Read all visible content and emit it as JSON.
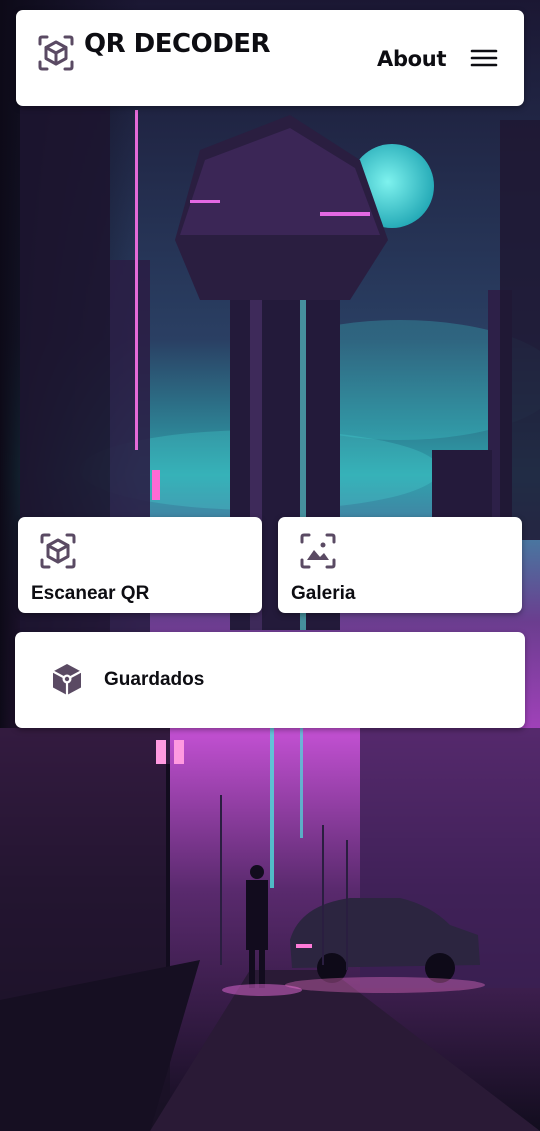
{
  "header": {
    "app_title": "QR DECODER",
    "about_label": "About",
    "logo_icon": "qr-scan-cube-icon",
    "menu_icon": "hamburger-menu-icon"
  },
  "actions": {
    "scan": {
      "label": "Escanear QR",
      "icon": "qr-scan-cube-icon"
    },
    "gallery": {
      "label": "Galeria",
      "icon": "image-gallery-icon"
    },
    "saved": {
      "label": "Guardados",
      "icon": "saved-cube-icon"
    }
  },
  "colors": {
    "icon": "#5a4a63",
    "text": "#0d0d12",
    "card": "#ffffff",
    "bg_neon_pink": "#d24bd8",
    "bg_neon_cyan": "#3fd6d6",
    "bg_dark": "#141024"
  }
}
